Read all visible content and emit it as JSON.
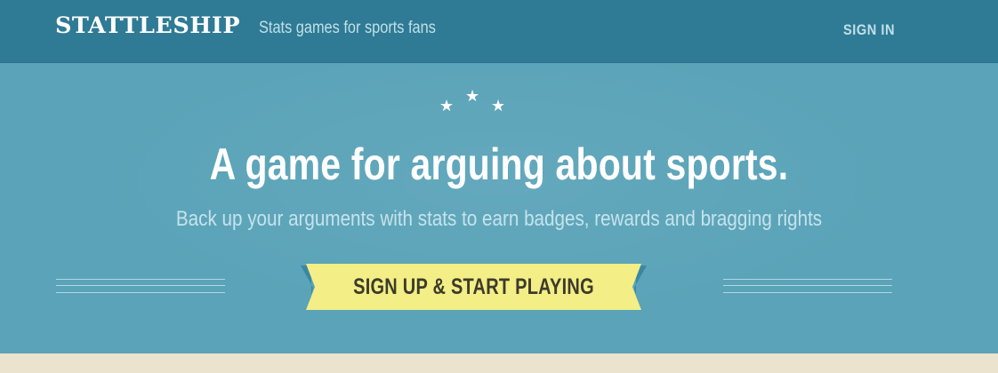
{
  "header": {
    "brand": "STATTLESHIP",
    "tagline": "Stats games for sports fans",
    "signin_label": "SIGN IN"
  },
  "hero": {
    "star_icon": "★",
    "headline": "A game for arguing about sports.",
    "subhead": "Back up your arguments with stats to earn badges, rewards and bragging rights",
    "cta_label": "SIGN UP & START PLAYING"
  },
  "colors": {
    "header_bg": "#2f7a94",
    "hero_bg": "#5aa3b8",
    "cta_bg": "#f3ee86",
    "cta_ribbon_tail": "#3b87a3",
    "footer_bg": "#ece3cf"
  }
}
